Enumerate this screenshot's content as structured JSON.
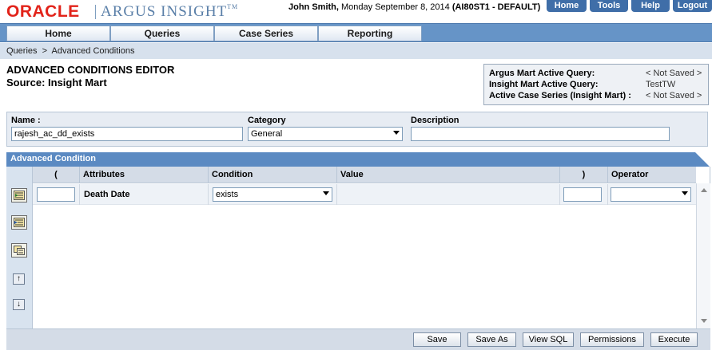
{
  "header": {
    "logo_brand": "ORACLE",
    "logo_product": "ARGUS INSIGHT",
    "logo_tm": "TM",
    "user_name": "John Smith,",
    "date_text": " Monday September 8, 2014 ",
    "db_text": "(AI80ST1 - DEFAULT)",
    "top_links": [
      "Home",
      "Tools",
      "Help",
      "Logout"
    ]
  },
  "nav": {
    "tabs": [
      "Home",
      "Queries",
      "Case Series",
      "Reporting"
    ]
  },
  "breadcrumb": {
    "items": [
      "Queries",
      ">",
      "Advanced Conditions"
    ]
  },
  "page": {
    "title": "ADVANCED CONDITIONS EDITOR",
    "source": "Source: Insight Mart"
  },
  "active_box": {
    "rows": [
      {
        "label": "Argus Mart Active Query:",
        "value": "< Not Saved >"
      },
      {
        "label": "Insight Mart Active Query:",
        "value": "TestTW"
      },
      {
        "label": "Active Case Series (Insight Mart) :",
        "value": "< Not Saved >"
      }
    ]
  },
  "form": {
    "name_label": "Name :",
    "name_value": "rajesh_ac_dd_exists",
    "category_label": "Category",
    "category_value": "General",
    "description_label": "Description",
    "description_value": ""
  },
  "advanced": {
    "title": "Advanced Condition",
    "columns": [
      "(",
      "Attributes",
      "Condition",
      "Value",
      ")",
      "Operator"
    ],
    "row": {
      "open_paren": "",
      "attribute": "Death Date",
      "condition": "exists",
      "value": "",
      "close_paren": "",
      "operator": ""
    },
    "side_icons": [
      "add-condition-icon",
      "insert-condition-icon",
      "copy-condition-icon",
      "move-up-icon",
      "move-down-icon"
    ],
    "move_up": "↑",
    "move_down": "↓"
  },
  "footer": {
    "buttons": [
      "Save",
      "Save As",
      "View SQL",
      "Permissions",
      "Execute"
    ]
  },
  "colors": {
    "oracle_red": "#e2231a",
    "nav_blue": "#6694c7",
    "panel_header": "#5b8ac2"
  }
}
